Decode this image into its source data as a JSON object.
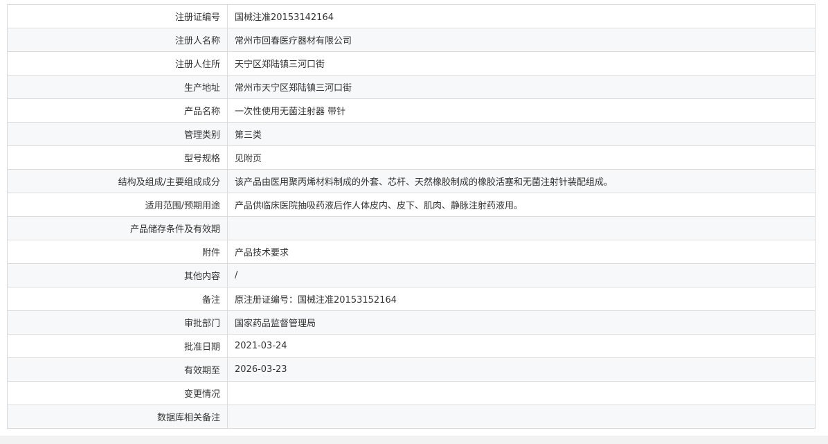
{
  "rows": [
    {
      "label": "注册证编号",
      "value": "国械注准20153142164"
    },
    {
      "label": "注册人名称",
      "value": "常州市回春医疗器材有限公司"
    },
    {
      "label": "注册人住所",
      "value": "天宁区郑陆镇三河口街"
    },
    {
      "label": "生产地址",
      "value": "常州市天宁区郑陆镇三河口街"
    },
    {
      "label": "产品名称",
      "value": "一次性使用无菌注射器 带针"
    },
    {
      "label": "管理类别",
      "value": "第三类"
    },
    {
      "label": "型号规格",
      "value": "见附页"
    },
    {
      "label": "结构及组成/主要组成成分",
      "value": "该产品由医用聚丙烯材料制成的外套、芯杆、天然橡胶制成的橡胶活塞和无菌注射针装配组成。"
    },
    {
      "label": "适用范围/预期用途",
      "value": "产品供临床医院抽吸药液后作人体皮内、皮下、肌肉、静脉注射药液用。"
    },
    {
      "label": "产品储存条件及有效期",
      "value": ""
    },
    {
      "label": "附件",
      "value": "产品技术要求"
    },
    {
      "label": "其他内容",
      "value": "/"
    },
    {
      "label": "备注",
      "value": "原注册证编号：国械注准20153152164"
    },
    {
      "label": "审批部门",
      "value": "国家药品监督管理局"
    },
    {
      "label": "批准日期",
      "value": "2021-03-24"
    },
    {
      "label": "有效期至",
      "value": "2026-03-23"
    },
    {
      "label": "变更情况",
      "value": ""
    },
    {
      "label": "数据库相关备注",
      "value": ""
    }
  ]
}
